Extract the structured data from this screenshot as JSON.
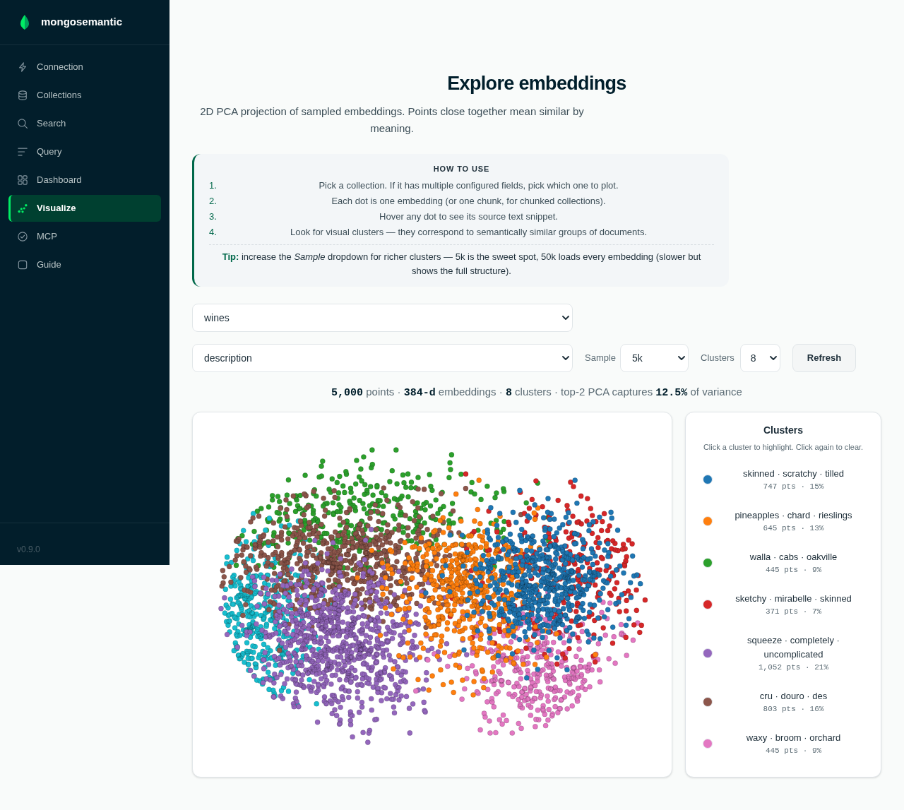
{
  "sidebar": {
    "brand": "mongosemantic",
    "items": [
      {
        "label": "Connection",
        "selected": false
      },
      {
        "label": "Collections",
        "selected": false
      },
      {
        "label": "Search",
        "selected": false
      },
      {
        "label": "Query",
        "selected": false
      },
      {
        "label": "Dashboard",
        "selected": false
      },
      {
        "label": "Visualize",
        "selected": true
      },
      {
        "label": "MCP",
        "selected": false
      },
      {
        "label": "Guide",
        "selected": false
      }
    ],
    "version": "v0.9.0"
  },
  "page": {
    "title": "Explore embeddings",
    "subtitle": "2D PCA projection of sampled embeddings. Points close together mean similar by meaning."
  },
  "how_to_use": {
    "heading": "HOW TO USE",
    "steps": [
      {
        "number": "1.",
        "text": "Pick a collection. If it has multiple configured fields, pick which one to plot."
      },
      {
        "number": "2.",
        "text": "Each dot is one embedding (or one chunk, for chunked collections)."
      },
      {
        "number": "3.",
        "text": "Hover any dot to see its source text snippet."
      },
      {
        "number": "4.",
        "text": "Look for visual clusters — they correspond to semantically similar groups of documents."
      }
    ],
    "tip": "**Tip:** increase the *Sample* dropdown for richer clusters — 5k is the sweet spot, 50k loads every embedding (slower but shows the full structure)."
  },
  "controls": {
    "collection": {
      "value": "wines"
    },
    "field": {
      "value": "description"
    },
    "sample": {
      "label": "Sample",
      "value": "5k"
    },
    "clusters": {
      "label": "Clusters",
      "value": "8"
    },
    "refresh": "Refresh"
  },
  "stats": "**5,000** points · **384-d** embeddings · **8** clusters · top-2 PCA captures **12.5%** of variance",
  "plot": {
    "series": [
      {
        "color": "#1f77b4"
      },
      {
        "color": "#ff7f0e"
      },
      {
        "color": "#2ca02c"
      },
      {
        "color": "#d62728"
      },
      {
        "color": "#9467bd"
      },
      {
        "color": "#8c564b"
      },
      {
        "color": "#e377c2"
      },
      {
        "color": "#17becf"
      }
    ]
  },
  "legend": {
    "title": "Clusters",
    "hint": "Click a cluster to highlight. Click again to clear.",
    "clusters": [
      {
        "label": "skinned · scratchy · tilled",
        "count": "747 pts · 15%",
        "color": "#1f77b4"
      },
      {
        "label": "pineapples · chard · rieslings",
        "count": "645 pts · 13%",
        "color": "#ff7f0e"
      },
      {
        "label": "walla · cabs · oakville",
        "count": "445 pts · 9%",
        "color": "#2ca02c"
      },
      {
        "label": "sketchy · mirabelle · skinned",
        "count": "371 pts · 7%",
        "color": "#d62728"
      },
      {
        "label": "squeeze · completely · uncomplicated",
        "count": "1,052 pts · 21%",
        "color": "#9467bd"
      },
      {
        "label": "cru · douro · des",
        "count": "803 pts · 16%",
        "color": "#8c564b"
      },
      {
        "label": "waxy · broom · orchard",
        "count": "445 pts · 9%",
        "color": "#e377c2"
      }
    ]
  }
}
